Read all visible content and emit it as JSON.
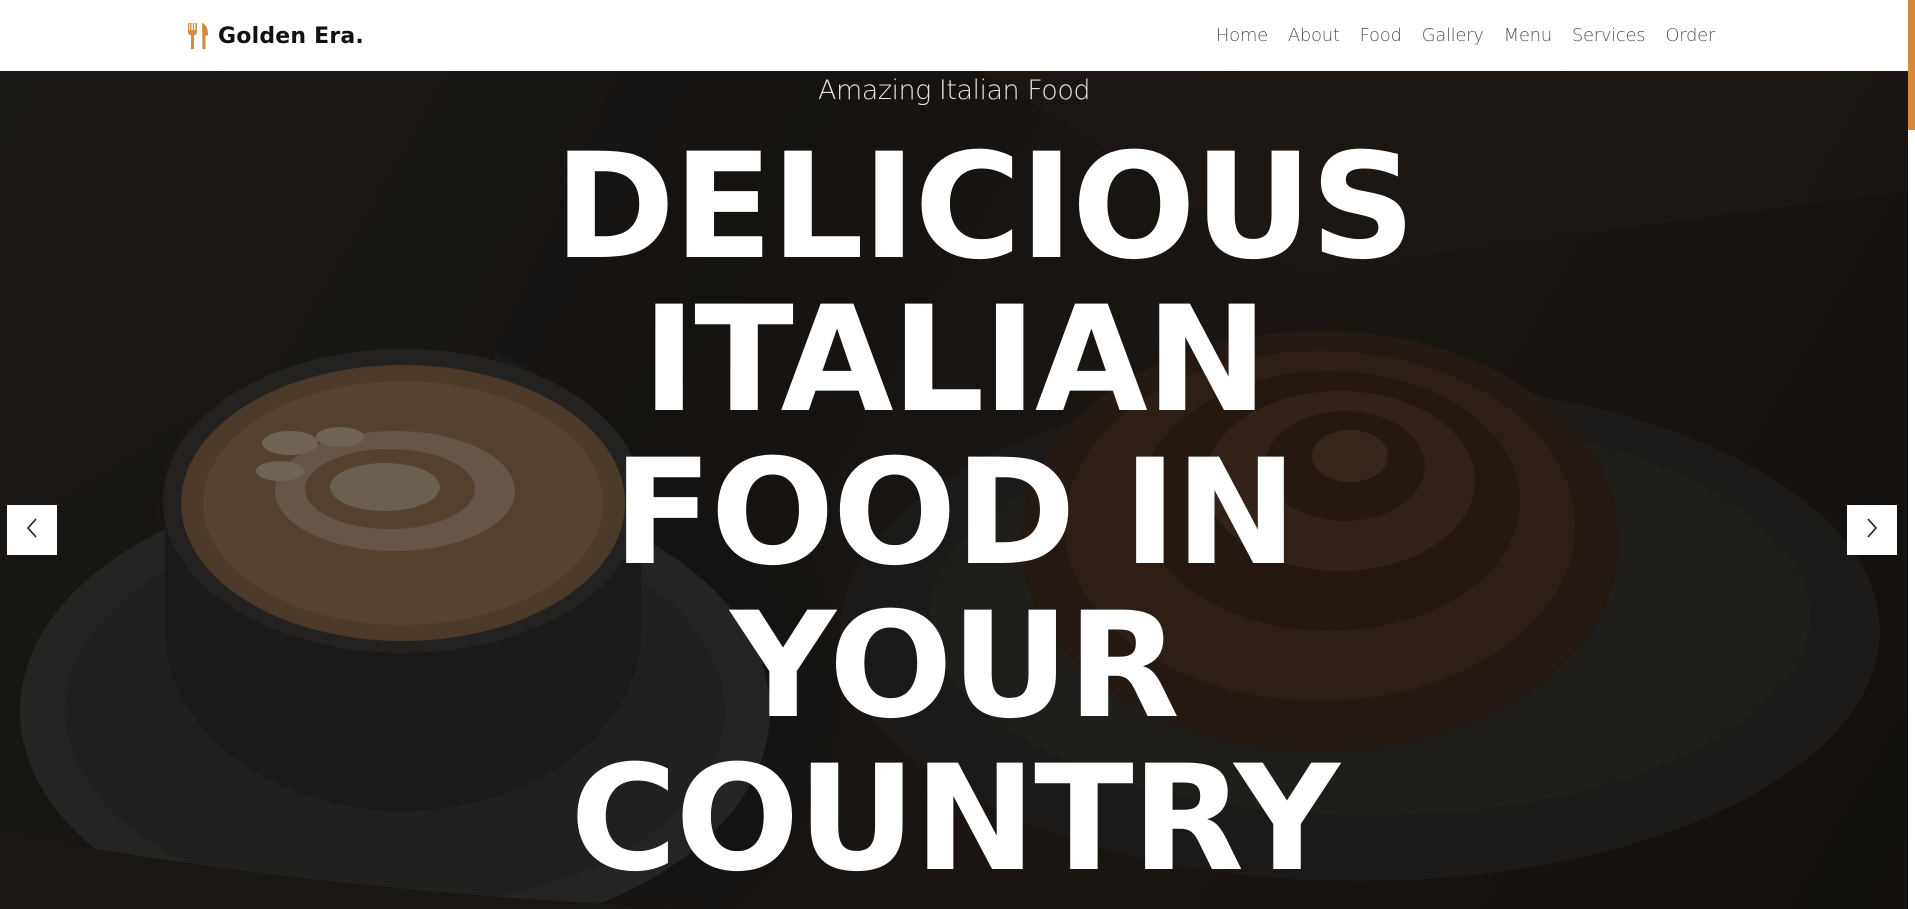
{
  "brand": {
    "name": "Golden Era.",
    "icon": "cutlery-icon",
    "accent_color": "#d68a3c"
  },
  "nav": {
    "items": [
      "Home",
      "About",
      "Food",
      "Gallery",
      "Menu",
      "Services",
      "Order"
    ]
  },
  "hero": {
    "subtitle": "Amazing Italian Food",
    "headline": "DELICIOUS ITALIAN FOOD IN YOUR COUNTRY",
    "prev_icon": "chevron-left-icon",
    "next_icon": "chevron-right-icon"
  }
}
